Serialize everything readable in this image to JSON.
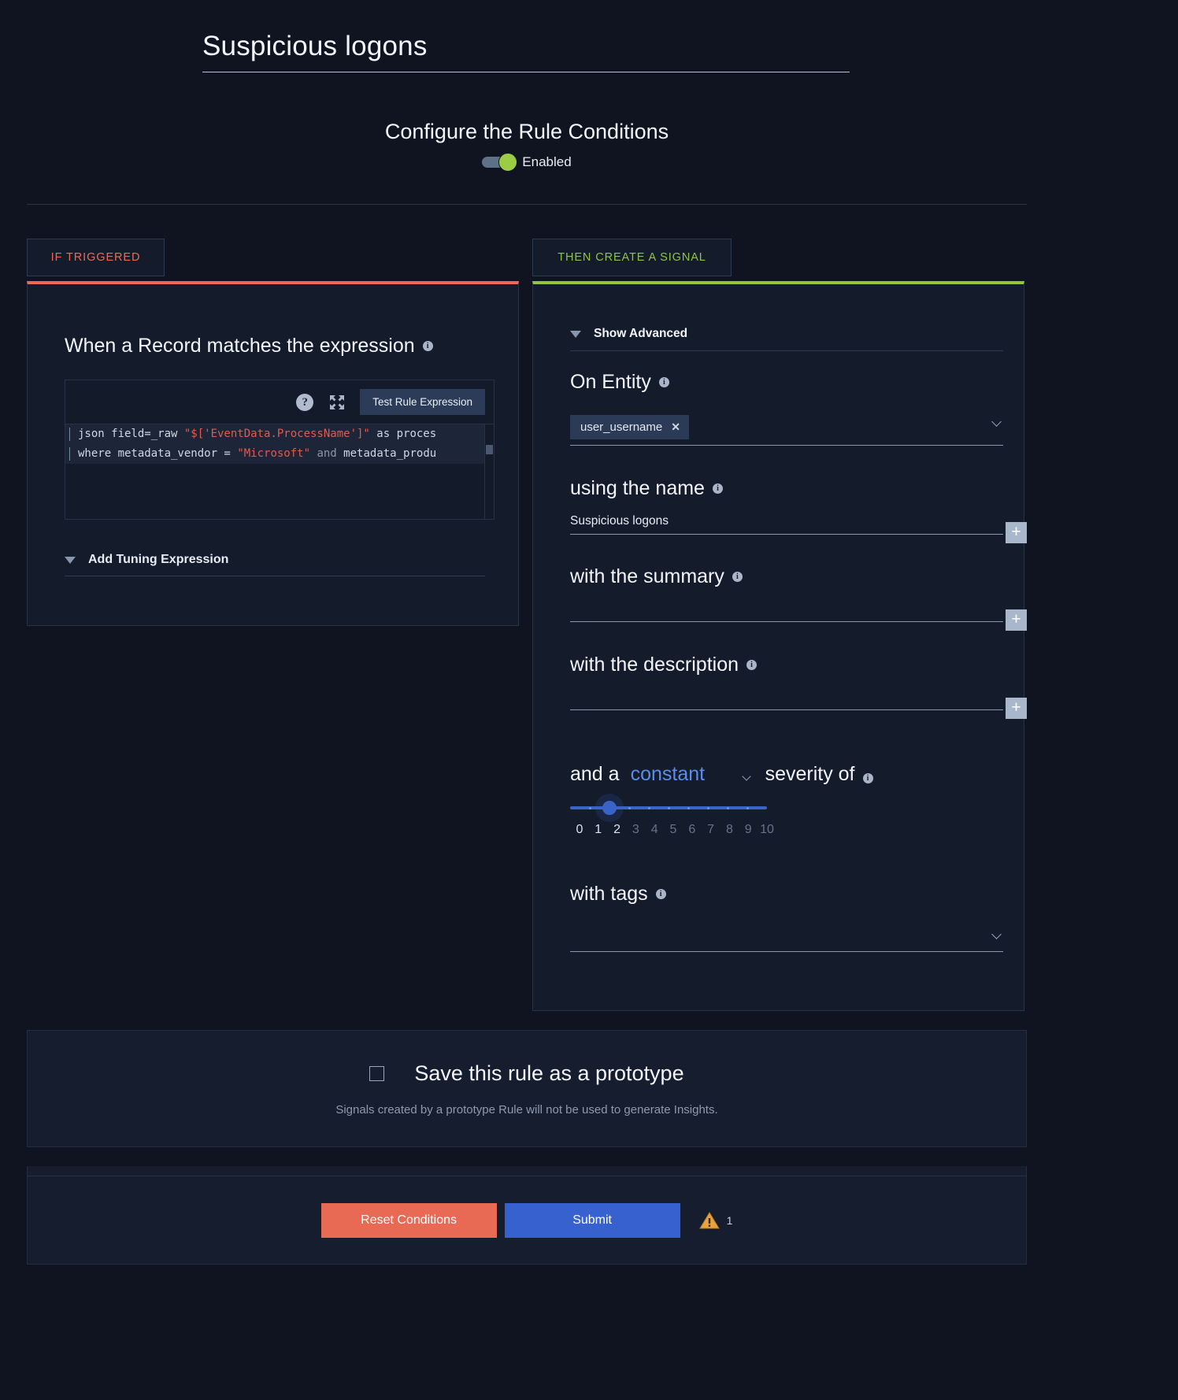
{
  "header": {
    "rule_title": "Suspicious logons",
    "subtitle": "Configure the Rule Conditions",
    "toggle_label": "Enabled",
    "toggle_state": "on"
  },
  "left_panel": {
    "tab_label": "IF TRIGGERED",
    "accent_color": "#ef6a55",
    "expression_heading": "When a Record matches the expression",
    "toolbar": {
      "help_icon": "help-circle-icon",
      "expand_icon": "expand-arrows-icon",
      "test_button": "Test Rule Expression"
    },
    "code_lines": [
      [
        {
          "t": "json field=_raw ",
          "c": "plain"
        },
        {
          "t": "\"$['EventData.ProcessName']\"",
          "c": "str"
        },
        {
          "t": " as proces",
          "c": "plain"
        }
      ],
      [
        {
          "t": "where metadata_vendor = ",
          "c": "plain"
        },
        {
          "t": "\"Microsoft\"",
          "c": "str"
        },
        {
          "t": " and ",
          "c": "kw"
        },
        {
          "t": "metadata_produ",
          "c": "plain"
        }
      ]
    ],
    "tuning_label": "Add Tuning Expression",
    "tuning_caret": "caret-down-icon"
  },
  "right_panel": {
    "tab_label": "THEN CREATE A SIGNAL",
    "accent_color": "#8fc53f",
    "show_advanced": "Show Advanced",
    "entity": {
      "title": "On Entity",
      "chip": "user_username",
      "chip_remove": "✕"
    },
    "name": {
      "title": "using the name",
      "value": "Suspicious logons",
      "add": "+"
    },
    "summary": {
      "title": "with the summary",
      "value": "",
      "add": "+"
    },
    "description": {
      "title": "with the description",
      "value": "",
      "add": "+"
    },
    "severity": {
      "prefix": "and a",
      "mode": "constant",
      "suffix": "severity of",
      "value": 2,
      "min": 0,
      "max": 10,
      "ticks": [
        "0",
        "1",
        "2",
        "3",
        "4",
        "5",
        "6",
        "7",
        "8",
        "9",
        "10"
      ],
      "accent": "#3a63c8"
    },
    "tags": {
      "title": "with tags",
      "value": ""
    }
  },
  "prototype": {
    "checked": false,
    "label": "Save this rule as a prototype",
    "note": "Signals created by a prototype Rule will not be used to generate Insights."
  },
  "footer": {
    "reset_label": "Reset Conditions",
    "submit_label": "Submit",
    "warning_icon": "warning-triangle-icon",
    "warning_count": "1"
  }
}
